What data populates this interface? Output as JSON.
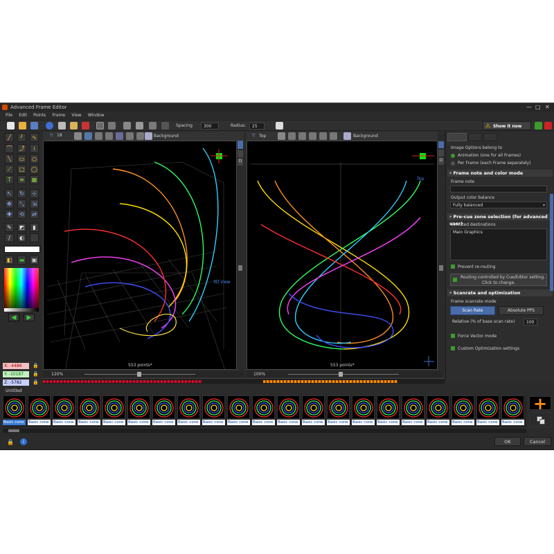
{
  "window": {
    "title": "Advanced Frame Editor",
    "controls": [
      "—",
      "□",
      "✕"
    ]
  },
  "menu": [
    "File",
    "Edit",
    "Points",
    "Frame",
    "View",
    "Window"
  ],
  "toolbar": {
    "spacing_label": "Spacing",
    "spacing_value": "300",
    "radius_label": "Radius:",
    "radius_value": "25",
    "show_it_now": "Show it now"
  },
  "left_view": {
    "label": "18",
    "background_label": "Background",
    "points": "553 points*",
    "zoom": "120%",
    "view_name": "3D View"
  },
  "right_view": {
    "label": "Top",
    "background_label": "Background",
    "points": "553 points*",
    "zoom": "100%",
    "view_name": "Top"
  },
  "coords": {
    "x": "X: -4486",
    "y": "Y: -10187",
    "z": "Z: -5782"
  },
  "panel": {
    "image_options_title": "Image Options belong to",
    "opt_animation": "Animation (one for all Frames)",
    "opt_per_frame": "Per Frame (each Frame separately)",
    "frame_note_header": "Frame note and color mode",
    "frame_note_label": "Frame note",
    "frame_note_value": "",
    "color_balance_label": "Output color balance",
    "color_balance_value": "Fully balanced",
    "precue_header": "Pre-cue zone selection (for advanced user)",
    "destinations_label": "Selected destinations",
    "destinations_value": "Main Graphics",
    "prevent_rerouting": "Prevent re-routing",
    "routing_line1": "Routing controlled by Cue/Editor setting.",
    "routing_line2": "Click to change.",
    "scanrate_header": "Scanrate and optimization",
    "scanmode_label": "Frame scanrate mode",
    "scan_rate_btn": "Scan Rate",
    "absolute_pps_btn": "Absolute PPS",
    "relative_label": "Relative (% of base scan rate)",
    "relative_value": "100",
    "force_vector": "Force Vector mode",
    "custom_opt": "Custom Optimization settings"
  },
  "timeline": {
    "title": "Untitled",
    "frames": [
      "Basic cone",
      "Basic cone",
      "Basic cone",
      "Basic cone",
      "Basic cone",
      "Basic cone",
      "Basic cone",
      "Basic cone",
      "Basic cone",
      "Basic cone",
      "Basic cone",
      "Basic cone",
      "Basic cone",
      "Basic cone",
      "Basic cone",
      "Basic cone",
      "Basic cone",
      "Basic cone",
      "Basic cone",
      "Basic cone",
      "Basic cone"
    ]
  },
  "footer": {
    "ok": "OK",
    "cancel": "Cancel"
  },
  "colors": {
    "accent_blue": "#3a7bd5",
    "frame_label_bg": "#ffffff",
    "timeline_red": "#c8102e",
    "timeline_orange": "#ff8c00"
  }
}
